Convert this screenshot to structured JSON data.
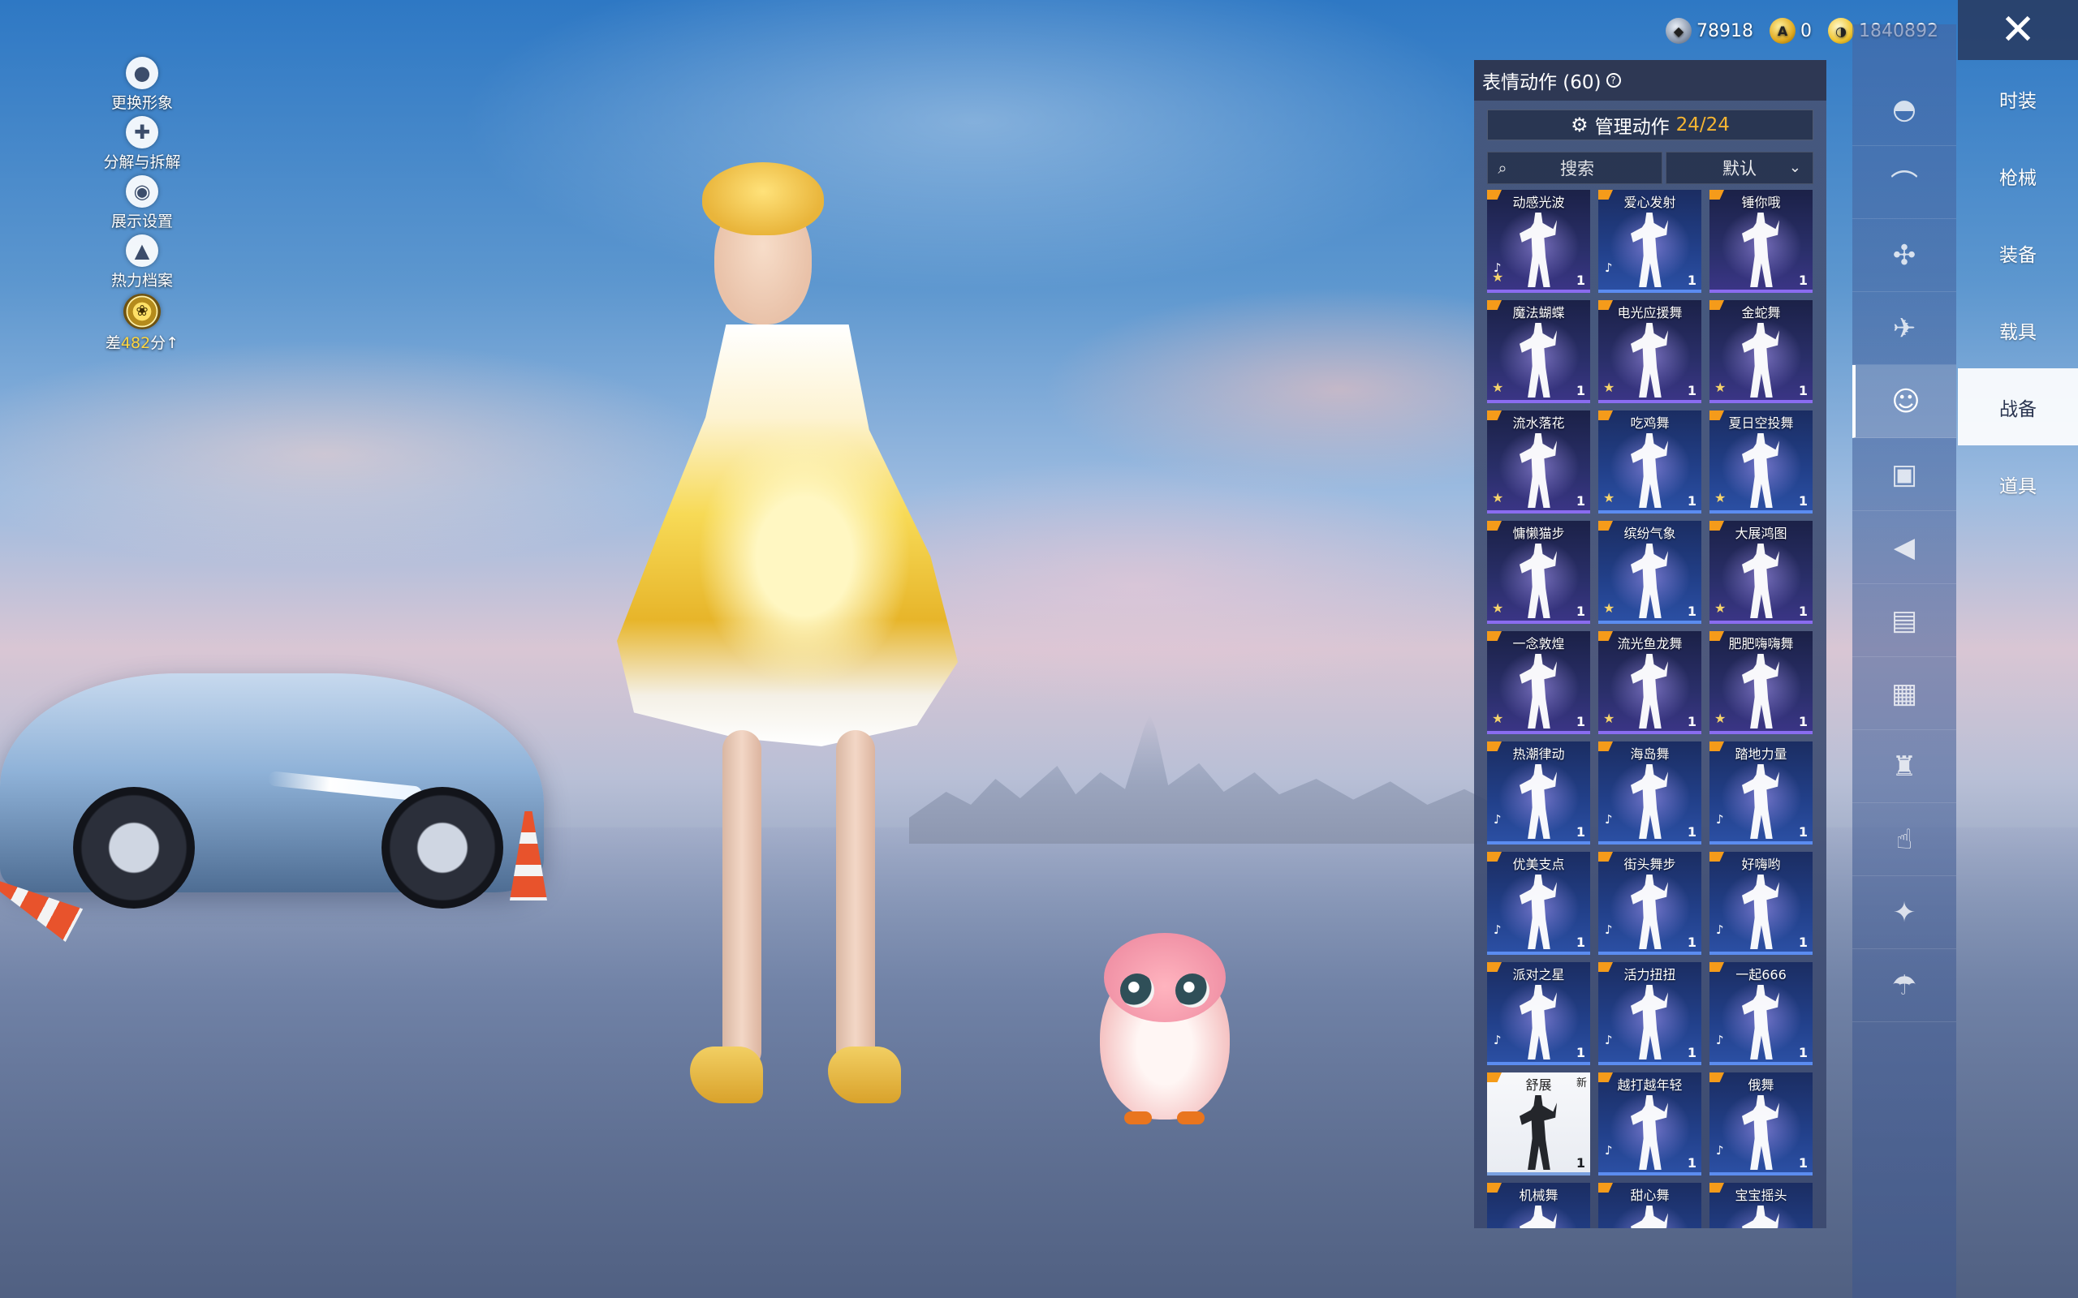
{
  "currencies": [
    {
      "icon": "silver-coin-icon",
      "value": "78918"
    },
    {
      "icon": "a-coin-icon",
      "value": "0"
    },
    {
      "icon": "gold-coin-icon",
      "value": "1840892"
    }
  ],
  "left_menu": [
    {
      "icon": "avatar-icon",
      "label": "更换形象"
    },
    {
      "icon": "puzzle-icon",
      "label": "分解与拆解"
    },
    {
      "icon": "eye-icon",
      "label": "展示设置"
    },
    {
      "icon": "flame-icon",
      "label": "热力档案"
    }
  ],
  "tier_progress": {
    "prefix": "差",
    "points": "482",
    "suffix": "分",
    "arrow": "↑"
  },
  "emote_panel": {
    "title": "表情动作 (60)",
    "help": "?",
    "manage_label": "管理动作",
    "manage_count": "24/24",
    "search_placeholder": "搜索",
    "sort_value": "默认",
    "emotes": [
      {
        "name": "动感光波",
        "style": "purple",
        "note": "♪",
        "star": true
      },
      {
        "name": "爱心发射",
        "style": "blue",
        "note": "♪",
        "star": false
      },
      {
        "name": "锤你哦",
        "style": "purple",
        "note": "",
        "star": false
      },
      {
        "name": "魔法蝴蝶",
        "style": "purple",
        "note": "",
        "star": true
      },
      {
        "name": "电光应援舞",
        "style": "purple",
        "note": "",
        "star": true
      },
      {
        "name": "金蛇舞",
        "style": "purple",
        "note": "",
        "star": true
      },
      {
        "name": "流水落花",
        "style": "purple",
        "note": "",
        "star": true
      },
      {
        "name": "吃鸡舞",
        "style": "blue",
        "note": "",
        "star": true
      },
      {
        "name": "夏日空投舞",
        "style": "blue",
        "note": "",
        "star": true
      },
      {
        "name": "慵懒猫步",
        "style": "purple",
        "note": "",
        "star": true
      },
      {
        "name": "缤纷气象",
        "style": "blue",
        "note": "",
        "star": true
      },
      {
        "name": "大展鸿图",
        "style": "purple",
        "note": "",
        "star": true
      },
      {
        "name": "一念敦煌",
        "style": "purple",
        "note": "",
        "star": true
      },
      {
        "name": "流光鱼龙舞",
        "style": "purple",
        "note": "",
        "star": true
      },
      {
        "name": "肥肥嗨嗨舞",
        "style": "purple",
        "note": "",
        "star": true
      },
      {
        "name": "热潮律动",
        "style": "blue",
        "note": "♪",
        "star": false
      },
      {
        "name": "海岛舞",
        "style": "blue",
        "note": "♪",
        "star": false
      },
      {
        "name": "踏地力量",
        "style": "blue",
        "note": "♪",
        "star": false
      },
      {
        "name": "优美支点",
        "style": "blue",
        "note": "♪",
        "star": false
      },
      {
        "name": "街头舞步",
        "style": "blue",
        "note": "♪",
        "star": false
      },
      {
        "name": "好嗨哟",
        "style": "blue",
        "note": "♪",
        "star": false
      },
      {
        "name": "派对之星",
        "style": "blue",
        "note": "♪",
        "star": false
      },
      {
        "name": "活力扭扭",
        "style": "blue",
        "note": "♪",
        "star": false
      },
      {
        "name": "一起666",
        "style": "blue",
        "note": "♪",
        "star": false
      },
      {
        "name": "舒展",
        "style": "white",
        "note": "",
        "star": false,
        "new": "新"
      },
      {
        "name": "越打越年轻",
        "style": "blue",
        "note": "♪",
        "star": false
      },
      {
        "name": "俄舞",
        "style": "blue",
        "note": "♪",
        "star": false
      },
      {
        "name": "机械舞",
        "style": "blue",
        "note": "",
        "star": false
      },
      {
        "name": "甜心舞",
        "style": "blue",
        "note": "",
        "star": false
      },
      {
        "name": "宝宝摇头",
        "style": "blue",
        "note": "",
        "star": false
      }
    ],
    "emote_qty": "1"
  },
  "side_icons": [
    {
      "icon": "helmet-icon"
    },
    {
      "icon": "glider-icon"
    },
    {
      "icon": "drone-icon"
    },
    {
      "icon": "plane-icon"
    },
    {
      "icon": "emote-face-icon",
      "active": true
    },
    {
      "icon": "bot-icon"
    },
    {
      "icon": "speaker-icon"
    },
    {
      "icon": "sticker-icon"
    },
    {
      "icon": "gallery-icon"
    },
    {
      "icon": "spray-icon"
    },
    {
      "icon": "tap-icon"
    },
    {
      "icon": "magic-wand-icon"
    },
    {
      "icon": "parachute-icon"
    }
  ],
  "categories": [
    {
      "label": "时装"
    },
    {
      "label": "枪械"
    },
    {
      "label": "装备"
    },
    {
      "label": "载具"
    },
    {
      "label": "战备",
      "active": true
    },
    {
      "label": "道具"
    }
  ],
  "close_label": "✕",
  "colors": {
    "accent_count": "#f5b532",
    "tier_points": "#ffd640",
    "epic_border": "#8a6cf0",
    "rare_border": "#5b8cf0"
  }
}
